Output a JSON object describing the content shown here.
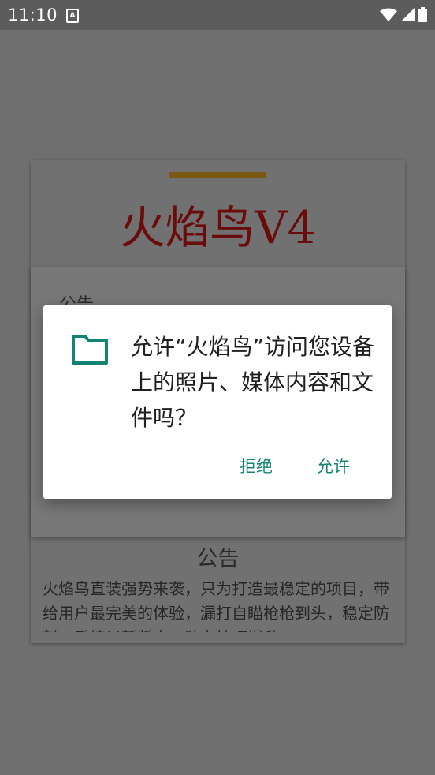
{
  "status_bar": {
    "time": "11:10",
    "notification_icon": "A",
    "icons": [
      "wifi-icon",
      "cell-signal-icon",
      "battery-icon"
    ]
  },
  "app": {
    "title": "火焰鸟V4",
    "notice_small": "公告",
    "notice_title": "公告",
    "notice_body": "火焰鸟直装强势来袭，只为打造最稳定的项目，带给用户最完美的体验，漏打自瞄枪枪到头，稳定防封，手持最新版本，助力技巧提升"
  },
  "dialog": {
    "icon": "folder-icon",
    "message": "允许“火焰鸟”访问您设备上的照片、媒体内容和文件吗？",
    "deny_label": "拒绝",
    "allow_label": "允许"
  },
  "colors": {
    "accent": "#138473",
    "title_red": "#6b0c0c",
    "bar_gold": "#7a5a12",
    "scrim": "#6f6f6f"
  }
}
